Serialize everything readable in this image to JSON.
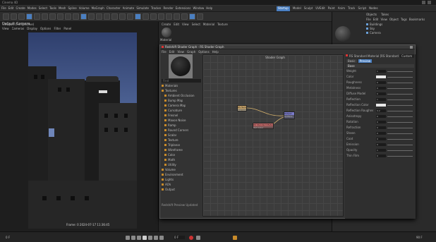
{
  "app": {
    "title": "Cinema 4D",
    "layout_label": "Startup",
    "menus": [
      "File",
      "Edit",
      "Create",
      "Modes",
      "Select",
      "Tools",
      "Mesh",
      "Spline",
      "Volume",
      "MoGraph",
      "Character",
      "Animate",
      "Simulate",
      "Tracker",
      "Render",
      "Extensions",
      "Window",
      "Help"
    ],
    "mode_tabs": [
      "Startup",
      "Model",
      "Sculpt",
      "UVEdit",
      "Paint",
      "Anim",
      "Track",
      "Script",
      "Nodes"
    ]
  },
  "viewport": {
    "title": "Viewport (Perspective)",
    "menus": [
      "View",
      "Cameras",
      "Display",
      "Options",
      "Filter",
      "Panel"
    ],
    "label": "Default Camera",
    "status_text": "Frame: 0  2024-07-17  11:36:45"
  },
  "object_manager": {
    "tabs": [
      "Objects",
      "Takes"
    ],
    "menus": [
      "File",
      "Edit",
      "View",
      "Object",
      "Tags",
      "Bookmarks"
    ],
    "items": [
      "Buildings",
      "Sky",
      "Camera"
    ]
  },
  "material_manager": {
    "menus": [
      "Create",
      "Edit",
      "View",
      "Select",
      "Material",
      "Texture"
    ],
    "material_name": "Material"
  },
  "node_editor": {
    "title": "Redshift Shader Graph - RS Shader Graph",
    "menus": [
      "File",
      "Edit",
      "View",
      "Graph",
      "Options",
      "Help"
    ],
    "graph_title": "Shader Graph",
    "find_placeholder": "Find",
    "tree": [
      "Materials",
      "Textures",
      "Ambient Occlusion",
      "Bump Map",
      "Camera Map",
      "Curvature",
      "Fresnel",
      "Maxon Noise",
      "Ramp",
      "Round Corners",
      "Scalar",
      "Texture",
      "Triplanar",
      "Wireframe",
      "Color",
      "Math",
      "Utility",
      "Volume",
      "Environment",
      "Lights",
      "AOV",
      "Output"
    ],
    "nodes": {
      "texture": {
        "title": "RS Texture",
        "port": "Out Color"
      },
      "material": {
        "title": "RS Standard Material",
        "port": "Out Color"
      },
      "output": {
        "title": "Output",
        "port": "Surface"
      }
    },
    "status_text": "Redshift Preview Updated"
  },
  "attributes": {
    "title": "RS Standard Material [RS Standard Material]",
    "mode_label": "Custom",
    "tabs": [
      "Basic",
      "Preview"
    ],
    "section": "Base",
    "rows": [
      {
        "label": "Weight",
        "value": "1"
      },
      {
        "label": "Color",
        "value": ""
      },
      {
        "label": "Roughness",
        "value": "0"
      },
      {
        "label": "Metalness",
        "value": "0"
      },
      {
        "label": "Diffuse Model",
        "value": "0"
      },
      {
        "label": "Reflection",
        "value": "1"
      },
      {
        "label": "Reflection Color",
        "value": ""
      },
      {
        "label": "Reflection Roughness",
        "value": "0.2"
      },
      {
        "label": "Anisotropy",
        "value": "0"
      },
      {
        "label": "Rotation",
        "value": "0"
      },
      {
        "label": "Refraction",
        "value": "0"
      },
      {
        "label": "Sheen",
        "value": "0"
      },
      {
        "label": "Coat",
        "value": "0"
      },
      {
        "label": "Emission",
        "value": "0"
      },
      {
        "label": "Opacity",
        "value": "1"
      },
      {
        "label": "Thin Film",
        "value": "0"
      }
    ]
  },
  "timeline": {
    "current_frame": "0 F",
    "start_frame": "0 F",
    "end_frame": "90 F"
  },
  "colors": {
    "accent": "#4a7fc1",
    "node_texture": "#c7a36a",
    "node_material": "#c46a6a",
    "node_output": "#7a7ac9",
    "wire": "#d7b36c"
  }
}
